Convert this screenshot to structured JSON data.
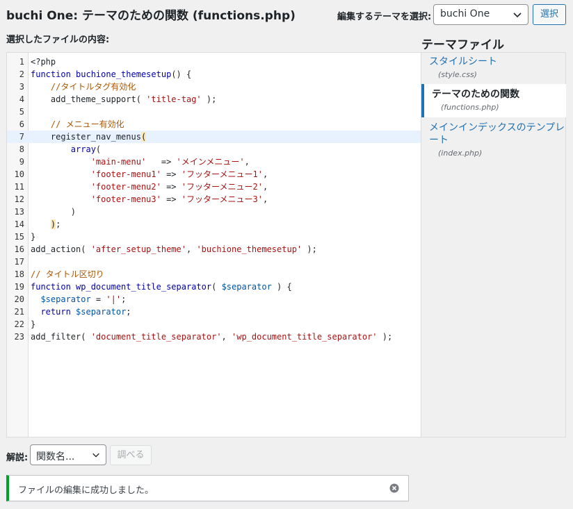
{
  "header": {
    "title": "buchi One: テーマのための関数 (functions.php)",
    "select_theme_label": "編集するテーマを選択:",
    "selected_theme": "buchi One",
    "select_button": "選択"
  },
  "editor": {
    "contents_label": "選択したファイルの内容:",
    "active_line": 7,
    "lines": [
      {
        "n": "1",
        "html": "&lt;?php"
      },
      {
        "n": "2",
        "html": "<span class=\"kw\">function</span> <span class=\"fn\">buchione_themesetup</span>() {"
      },
      {
        "n": "3",
        "html": "    <span class=\"cmt\">//タイトルタグ有効化</span>"
      },
      {
        "n": "4",
        "html": "    add_theme_support( <span class=\"str\">'title-tag'</span> );"
      },
      {
        "n": "5",
        "html": ""
      },
      {
        "n": "6",
        "html": "    <span class=\"cmt\">// メニュー有効化</span>"
      },
      {
        "n": "7",
        "html": "    register_nav_menus<span class=\"bracket-hl\">(</span>"
      },
      {
        "n": "8",
        "html": "        <span class=\"kw\">array</span>("
      },
      {
        "n": "9",
        "html": "            <span class=\"str\">'main-menu'</span>   =&gt; <span class=\"str\">'メインメニュー'</span>,"
      },
      {
        "n": "10",
        "html": "            <span class=\"str\">'footer-menu1'</span> =&gt; <span class=\"str\">'フッターメニュー1'</span>,"
      },
      {
        "n": "11",
        "html": "            <span class=\"str\">'footer-menu2'</span> =&gt; <span class=\"str\">'フッターメニュー2'</span>,"
      },
      {
        "n": "12",
        "html": "            <span class=\"str\">'footer-menu3'</span> =&gt; <span class=\"str\">'フッターメニュー3'</span>,"
      },
      {
        "n": "13",
        "html": "        )"
      },
      {
        "n": "14",
        "html": "    <span class=\"bracket-hl\">)</span>;"
      },
      {
        "n": "15",
        "html": "}"
      },
      {
        "n": "16",
        "html": "add_action( <span class=\"str\">'after_setup_theme'</span>, <span class=\"str\">'buchione_themesetup'</span> );"
      },
      {
        "n": "17",
        "html": ""
      },
      {
        "n": "18",
        "html": "<span class=\"cmt\">// タイトル区切り</span>"
      },
      {
        "n": "19",
        "html": "<span class=\"kw\">function</span> <span class=\"fn\">wp_document_title_separator</span>( <span class=\"var\">$separator</span> ) {"
      },
      {
        "n": "20",
        "html": "  <span class=\"var\">$separator</span> = <span class=\"str\">'|'</span>;"
      },
      {
        "n": "21",
        "html": "  <span class=\"kw\">return</span> <span class=\"var\">$separator</span>;"
      },
      {
        "n": "22",
        "html": "}"
      },
      {
        "n": "23",
        "html": "add_filter( <span class=\"str\">'document_title_separator'</span>, <span class=\"str\">'wp_document_title_separator'</span> );"
      }
    ]
  },
  "sidebar": {
    "heading": "テーマファイル",
    "files": [
      {
        "label": "スタイルシート",
        "file": "(style.css)",
        "current": false
      },
      {
        "label": "テーマのための関数",
        "file": "(functions.php)",
        "current": true
      },
      {
        "label": "メインインデックスのテンプレート",
        "file": "(index.php)",
        "current": false
      }
    ]
  },
  "documentation": {
    "label": "解説:",
    "select_value": "関数名...",
    "lookup_button": "調べる"
  },
  "notice": {
    "message": "ファイルの編集に成功しました。"
  },
  "colors": {
    "accent": "#2271b1",
    "success": "#00a32a"
  }
}
